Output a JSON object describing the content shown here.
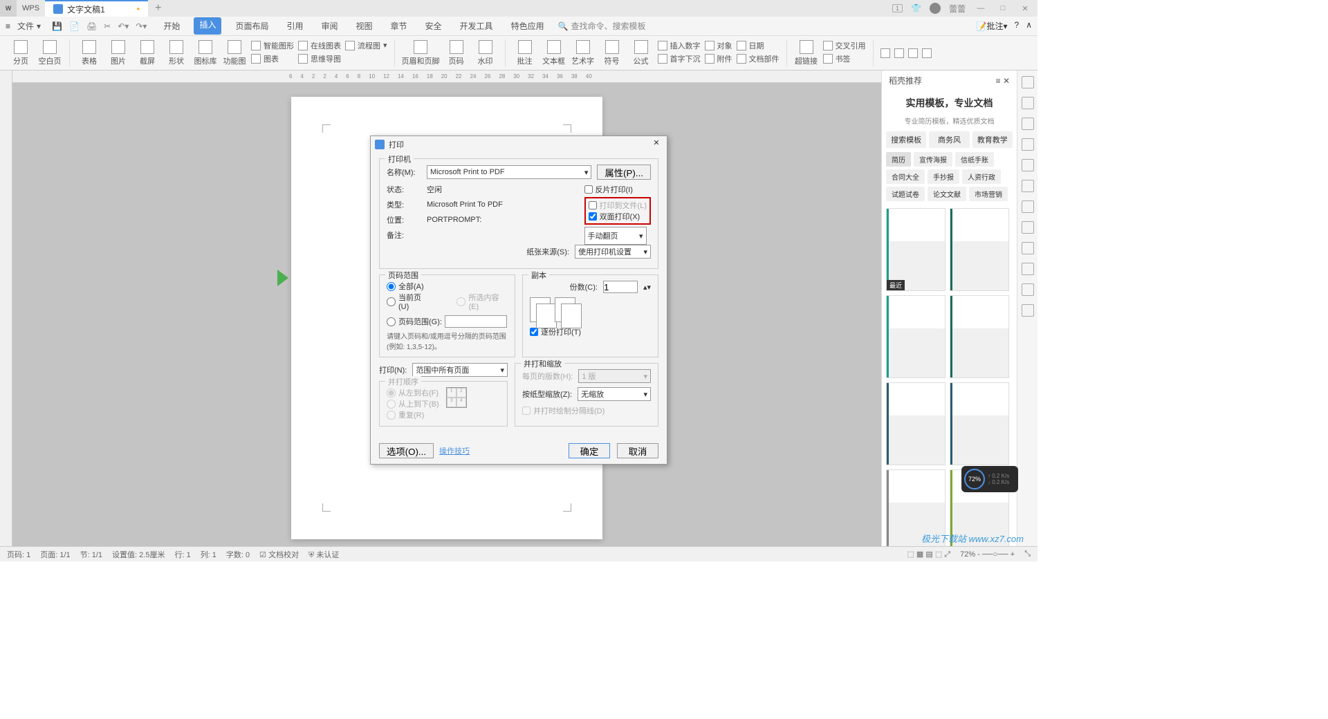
{
  "titlebar": {
    "app_name": "WPS",
    "doc_name": "文字文稿1",
    "doc_modified": "•",
    "new_tab": "+",
    "user_name": "蕾蕾",
    "badge": "1"
  },
  "menubar": {
    "file": "文件",
    "tabs": [
      "开始",
      "插入",
      "页面布局",
      "引用",
      "审阅",
      "视图",
      "章节",
      "安全",
      "开发工具",
      "特色应用"
    ],
    "active_tab": "插入",
    "search_placeholder": "查找命令、搜索模板",
    "right_label": "批注"
  },
  "ribbon": {
    "g1": [
      "分页",
      "空白页"
    ],
    "g2": [
      "表格",
      "图片",
      "截屏",
      "形状",
      "图标库",
      "功能图"
    ],
    "g3a": [
      "智能图形",
      "在线图表",
      "流程图"
    ],
    "g3b": [
      "图表",
      "思维导图"
    ],
    "g4": [
      "页眉和页脚",
      "页码",
      "水印"
    ],
    "g5": [
      "批注",
      "文本框",
      "艺术字",
      "符号",
      "公式"
    ],
    "g6a": [
      "插入数字",
      "对象",
      "日期"
    ],
    "g6b": [
      "首字下沉",
      "附件",
      "文档部件"
    ],
    "g7": [
      "超链接"
    ],
    "g7a": [
      "交叉引用",
      "书签"
    ]
  },
  "side": {
    "title": "稻壳推荐",
    "h1": "实用模板，专业文档",
    "sub": "专业简历模板，精选优质文档",
    "tabs": [
      "搜索模板",
      "商务风",
      "教育教学"
    ],
    "tags": [
      "简历",
      "宣传海报",
      "信纸手账",
      "合同大全",
      "手抄报",
      "人资行政",
      "试题试卷",
      "论文文献",
      "市场营销"
    ],
    "recent_label": "最近"
  },
  "statusbar": {
    "page": "页码: 1",
    "page_of": "页面: 1/1",
    "section": "节: 1/1",
    "pos": "设置值: 2.5厘米",
    "line": "行: 1",
    "col": "列: 1",
    "chars": "字数: 0",
    "proof": "文档校对",
    "cert": "未认证",
    "zoom": "72%"
  },
  "dialog": {
    "title": "打印",
    "printer_legend": "打印机",
    "name_label": "名称(M):",
    "name_value": "Microsoft Print to PDF",
    "props_btn": "属性(P)...",
    "status_label": "状态:",
    "status_value": "空闲",
    "type_label": "类型:",
    "type_value": "Microsoft Print To PDF",
    "location_label": "位置:",
    "location_value": "PORTPROMPT:",
    "comment_label": "备注:",
    "reverse": "反片打印(I)",
    "tofile": "打印到文件(L)",
    "duplex": "双面打印(X)",
    "manual_flip": "手动翻页",
    "source_label": "纸张来源(S):",
    "source_value": "使用打印机设置",
    "range_legend": "页码范围",
    "all": "全部(A)",
    "current": "当前页(U)",
    "selection": "所选内容(E)",
    "pages": "页码范围(G):",
    "range_hint": "请键入页码和/或用逗号分隔的页码范围(例如: 1,3,5-12)。",
    "copies_legend": "副本",
    "copies_label": "份数(C):",
    "copies_value": "1",
    "collate": "逐份打印(T)",
    "print_label": "打印(N):",
    "print_value": "范围中所有页面",
    "order_legend": "并打顺序",
    "lr": "从左到右(F)",
    "tb": "从上到下(B)",
    "repeat": "重复(R)",
    "scale_legend": "并打和缩放",
    "per_page": "每页的版数(H):",
    "per_page_value": "1 版",
    "scale_label": "按纸型缩放(Z):",
    "scale_value": "无缩放",
    "draw_border": "并打时绘制分隔线(D)",
    "options": "选项(O)...",
    "tips": "操作技巧",
    "ok": "确定",
    "cancel": "取消"
  },
  "widget": {
    "percent": "72%",
    "up": "0.2 K/s",
    "down": "0.2 K/s"
  },
  "watermark": "极光下载站  www.xz7.com",
  "ruler_marks": [
    "6",
    "4",
    "2",
    "2",
    "4",
    "6",
    "8",
    "10",
    "12",
    "14",
    "16",
    "18",
    "20",
    "22",
    "24",
    "26",
    "28",
    "30",
    "32",
    "34",
    "36",
    "38",
    "40"
  ]
}
